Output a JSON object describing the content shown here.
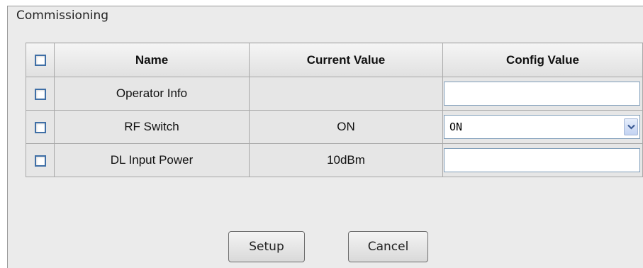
{
  "panel": {
    "title": "Commissioning"
  },
  "table": {
    "headers": {
      "name": "Name",
      "current": "Current Value",
      "config": "Config Value"
    },
    "rows": [
      {
        "name": "Operator Info",
        "current": "",
        "config": ""
      },
      {
        "name": "RF Switch",
        "current": "ON",
        "config": "ON"
      },
      {
        "name": "DL Input Power",
        "current": "10dBm",
        "config": ""
      }
    ]
  },
  "buttons": {
    "setup": "Setup",
    "cancel": "Cancel"
  },
  "icons": {
    "dropdown": "chevron-down-icon"
  },
  "colors": {
    "checkbox_border": "#3f6fa6",
    "panel_bg": "#ebebeb"
  }
}
